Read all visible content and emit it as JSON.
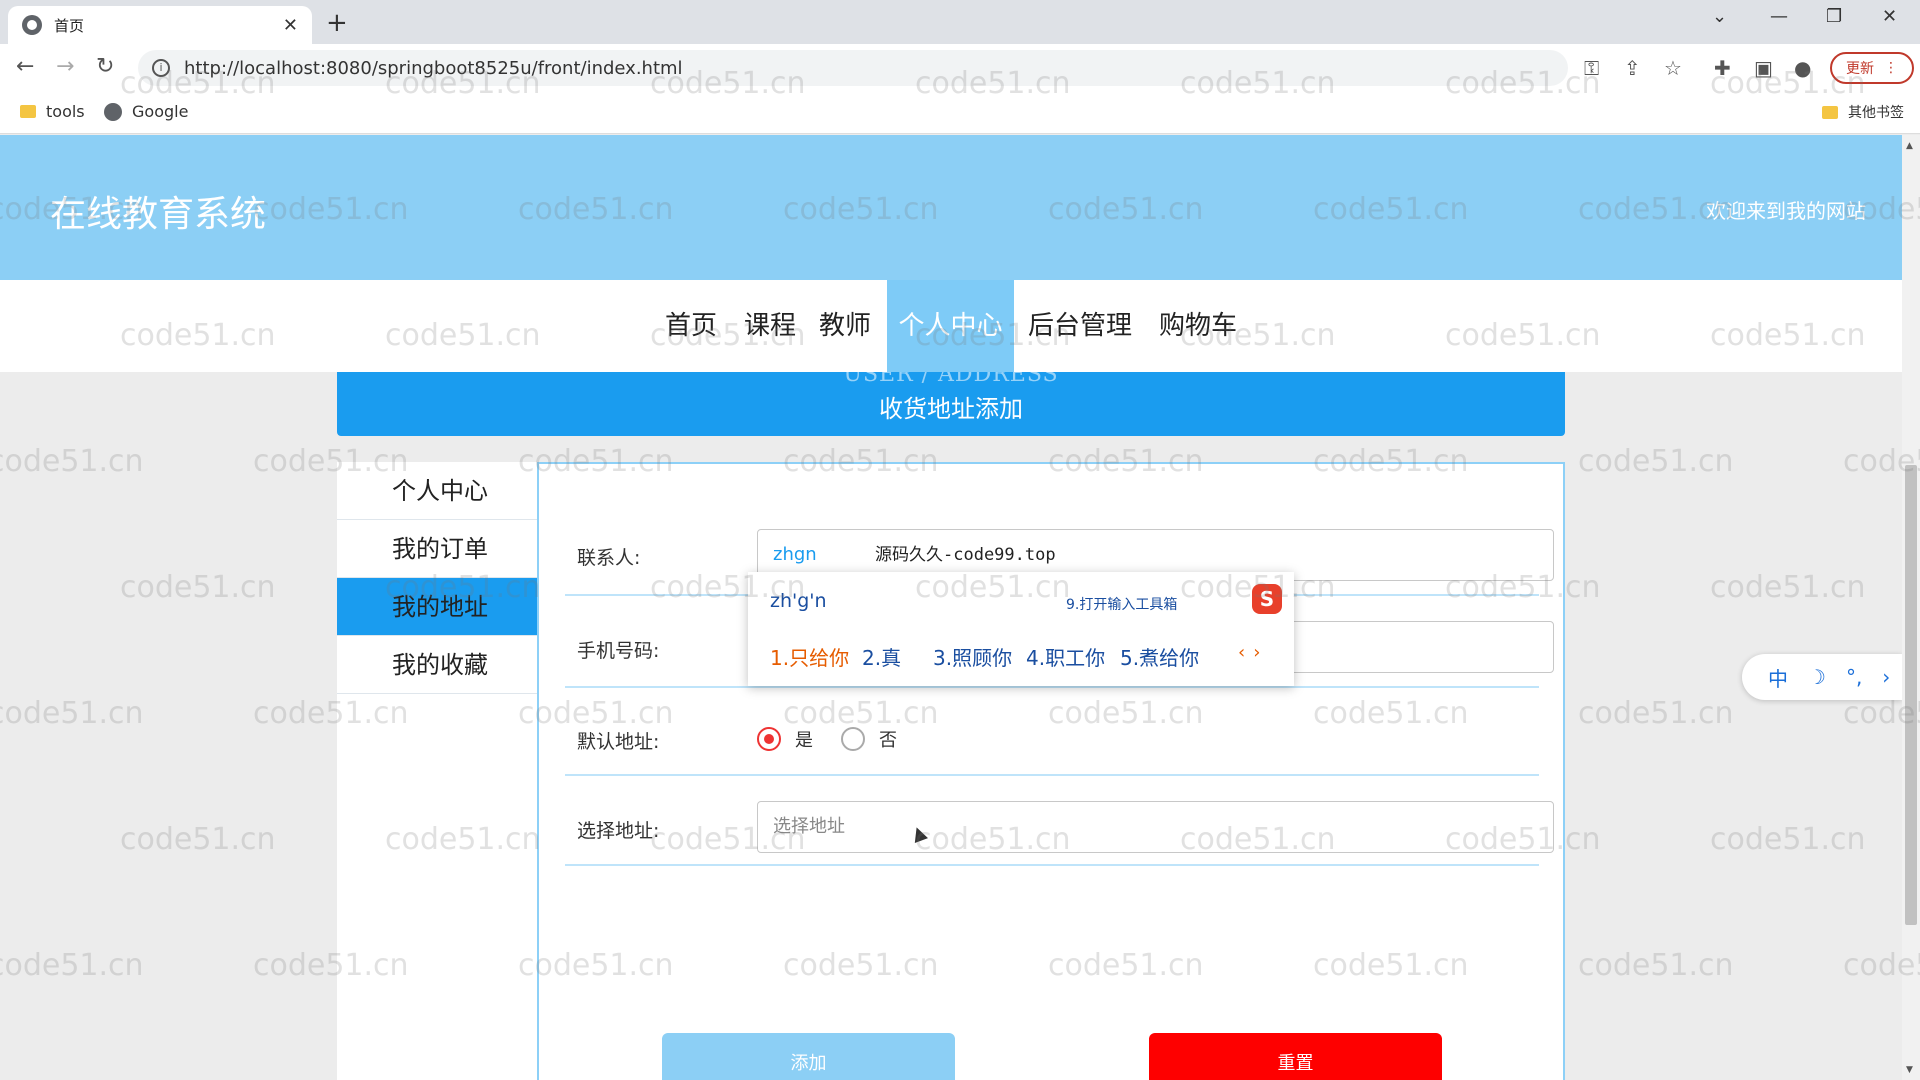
{
  "browser": {
    "tab_title": "首页",
    "tab_close": "✕",
    "new_tab": "+",
    "url": "http://localhost:8080/springboot8525u/front/index.html",
    "update_label": "更新",
    "bookmarks": [
      {
        "label": "tools",
        "icon": "folder-icon"
      },
      {
        "label": "Google",
        "icon": "globe-icon"
      }
    ],
    "other_bookmarks": "其他书签"
  },
  "site": {
    "title": "在线教育系统",
    "welcome": "欢迎来到我的网站"
  },
  "nav": {
    "items": [
      "首页",
      "课程",
      "教师",
      "个人中心",
      "后台管理",
      "购物车"
    ],
    "active_index": 3
  },
  "banner": {
    "en": "USER / ADDRESS",
    "cn": "收货地址添加"
  },
  "side_menu": {
    "items": [
      "个人中心",
      "我的订单",
      "我的地址",
      "我的收藏"
    ],
    "active_index": 2
  },
  "form": {
    "contact_label": "联系人:",
    "contact_value": "zhgn",
    "phone_label": "手机号码:",
    "default_label": "默认地址:",
    "default_options": [
      "是",
      "否"
    ],
    "default_selected": "是",
    "address_label": "选择地址:",
    "address_placeholder": "选择地址",
    "add_button": "添加",
    "reset_button": "重置"
  },
  "overlay_text": "源码久久-code99.top",
  "ime": {
    "composition": "zh'g'n",
    "hint": "9.打开输入工具箱",
    "logo": "S",
    "candidates": [
      "1.只给你",
      "2.真",
      "3.照顾你",
      "4.职工你",
      "5.煮给你"
    ],
    "toolbar": [
      "中",
      "☽",
      "°,",
      "›"
    ]
  },
  "watermark": "code51.cn",
  "colors": {
    "header": "#8ccff5",
    "accent": "#1a9cef",
    "reset": "#fe0000"
  }
}
